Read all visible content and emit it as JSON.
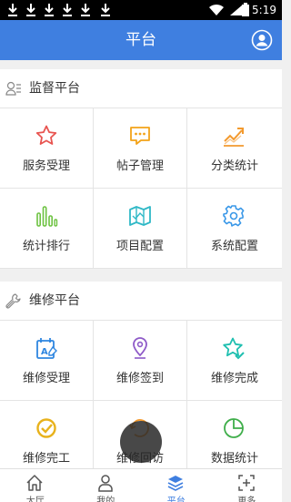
{
  "status_bar": {
    "time": "5:19"
  },
  "app_bar": {
    "title": "平台"
  },
  "sections": [
    {
      "title": "监督平台",
      "items": [
        {
          "label": "服务受理",
          "icon": "star-icon",
          "color": "#e85450"
        },
        {
          "label": "帖子管理",
          "icon": "chat-bubble-icon",
          "color": "#f3a319"
        },
        {
          "label": "分类统计",
          "icon": "trend-chart-icon",
          "color": "#f39a2e"
        },
        {
          "label": "统计排行",
          "icon": "bar-chart-icon",
          "color": "#6cc240"
        },
        {
          "label": "项目配置",
          "icon": "map-icon",
          "color": "#2fb8c6"
        },
        {
          "label": "系统配置",
          "icon": "gear-icon",
          "color": "#3a98e8"
        }
      ]
    },
    {
      "title": "维修平台",
      "items": [
        {
          "label": "维修受理",
          "icon": "calendar-edit-icon",
          "color": "#2f86e0"
        },
        {
          "label": "维修签到",
          "icon": "location-pin-icon",
          "color": "#8e5ac8"
        },
        {
          "label": "维修完成",
          "icon": "star-check-icon",
          "color": "#1fbfb0"
        },
        {
          "label": "维修完工",
          "icon": "check-circle-icon",
          "color": "#e8b21c"
        },
        {
          "label": "维修回访",
          "icon": "return-visit-icon",
          "color": "#f39a2e"
        },
        {
          "label": "数据统计",
          "icon": "pie-chart-icon",
          "color": "#3fae4a"
        }
      ]
    }
  ],
  "tabs": [
    {
      "label": "大厅",
      "icon": "home-icon",
      "active": false
    },
    {
      "label": "我的",
      "icon": "person-icon",
      "active": false
    },
    {
      "label": "平台",
      "icon": "layers-icon",
      "active": true
    },
    {
      "label": "更多",
      "icon": "scan-icon",
      "active": false
    }
  ],
  "accent_color": "#3f7fe0"
}
